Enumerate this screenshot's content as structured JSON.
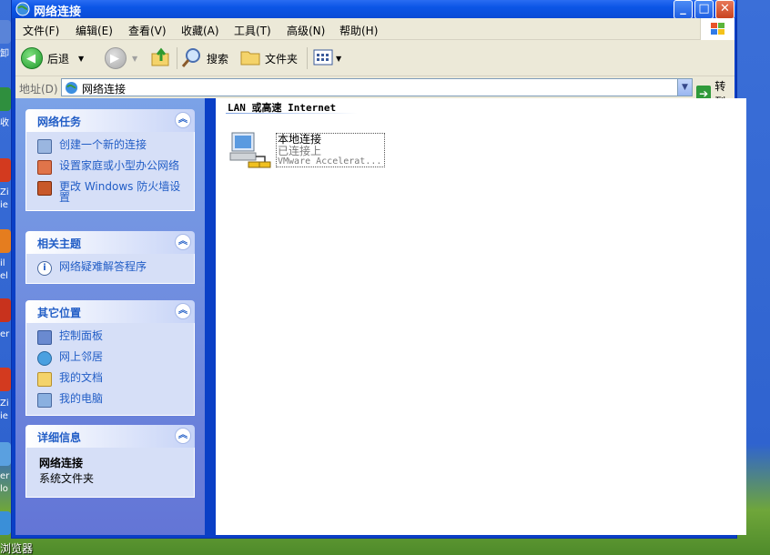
{
  "window": {
    "title": "网络连接"
  },
  "menu": [
    "文件(F)",
    "编辑(E)",
    "查看(V)",
    "收藏(A)",
    "工具(T)",
    "高级(N)",
    "帮助(H)"
  ],
  "toolbar": {
    "back_label": "后退",
    "search_label": "搜索",
    "folders_label": "文件夹"
  },
  "address": {
    "label": "地址(D)",
    "value": "网络连接",
    "go_label": "转到"
  },
  "taskpane": {
    "network_tasks": {
      "title": "网络任务",
      "items": [
        "创建一个新的连接",
        "设置家庭或小型办公网络",
        "更改 Windows 防火墙设置"
      ]
    },
    "related": {
      "title": "相关主题",
      "items": [
        "网络疑难解答程序"
      ]
    },
    "other_places": {
      "title": "其它位置",
      "items": [
        "控制面板",
        "网上邻居",
        "我的文档",
        "我的电脑"
      ]
    },
    "details": {
      "title": "详细信息",
      "name": "网络连接",
      "type": "系统文件夹"
    }
  },
  "content": {
    "group_title": "LAN 或高速 Internet",
    "connection": {
      "name": "本地连接",
      "status": "已连接上",
      "device": "VMware Accelerat..."
    }
  },
  "desktop": {
    "strip_labels": [
      "卸",
      "收",
      "Zi",
      "ie",
      "il",
      "el",
      "er",
      "Zi",
      "ie",
      "er",
      "lo"
    ],
    "bottom_label": "浏览器"
  }
}
